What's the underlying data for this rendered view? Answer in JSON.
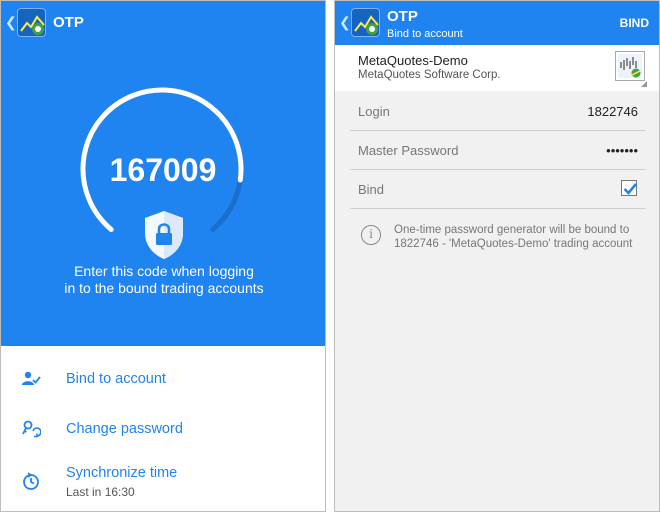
{
  "left_screen": {
    "actionbar": {
      "back_icon": "chevron-left-icon",
      "app_icon": "metatrader-app-icon",
      "title": "OTP"
    },
    "otp": {
      "code": "167009",
      "timer_remaining_fraction": 0.85,
      "caption_line1": "Enter this code when logging",
      "caption_line2": "in to the bound trading accounts",
      "shield_icon": "shield-lock-icon"
    },
    "menu": [
      {
        "icon": "person-check-icon",
        "label": "Bind to account"
      },
      {
        "icon": "key-refresh-icon",
        "label": "Change password"
      },
      {
        "icon": "timer-sync-icon",
        "label": "Synchronize time",
        "sublabel": "Last in 16:30"
      }
    ]
  },
  "right_screen": {
    "actionbar": {
      "back_icon": "chevron-left-icon",
      "app_icon": "metatrader-app-icon",
      "title": "OTP",
      "subtitle": "Bind to account",
      "action": "BIND"
    },
    "account": {
      "server": "MetaQuotes-Demo",
      "company": "MetaQuotes Software Corp.",
      "logo_icon": "metaquotes-broker-icon"
    },
    "fields": {
      "login_label": "Login",
      "login_value": "1822746",
      "password_label": "Master Password",
      "password_value": "•••••••",
      "bind_label": "Bind",
      "bind_checked": true
    },
    "info": {
      "icon": "info-circle-icon",
      "text": "One-time password generator will be bound to 1822746 - 'MetaQuotes-Demo' trading account"
    }
  },
  "colors": {
    "primary_blue": "#1f84f0",
    "background_gray": "#f1f1f1",
    "accent_text": "#1f84f0"
  }
}
